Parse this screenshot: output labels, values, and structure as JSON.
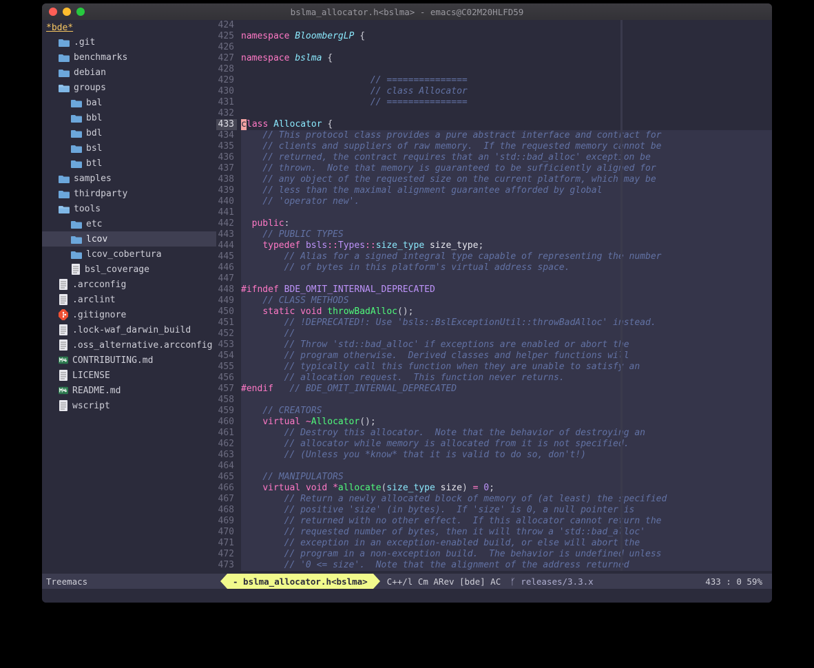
{
  "window": {
    "title": "bslma_allocator.h<bslma> - emacs@C02M20HLFD59"
  },
  "sidebar": {
    "root": "*bde*",
    "items": [
      {
        "type": "folder",
        "label": ".git",
        "indent": 1,
        "open": false
      },
      {
        "type": "folder",
        "label": "benchmarks",
        "indent": 1,
        "open": false
      },
      {
        "type": "folder",
        "label": "debian",
        "indent": 1,
        "open": false
      },
      {
        "type": "folder",
        "label": "groups",
        "indent": 1,
        "open": true
      },
      {
        "type": "folder",
        "label": "bal",
        "indent": 2,
        "open": false
      },
      {
        "type": "folder",
        "label": "bbl",
        "indent": 2,
        "open": false
      },
      {
        "type": "folder",
        "label": "bdl",
        "indent": 2,
        "open": false
      },
      {
        "type": "folder",
        "label": "bsl",
        "indent": 2,
        "open": false
      },
      {
        "type": "folder",
        "label": "btl",
        "indent": 2,
        "open": false
      },
      {
        "type": "folder",
        "label": "samples",
        "indent": 1,
        "open": false
      },
      {
        "type": "folder",
        "label": "thirdparty",
        "indent": 1,
        "open": false
      },
      {
        "type": "folder",
        "label": "tools",
        "indent": 1,
        "open": true
      },
      {
        "type": "folder",
        "label": "etc",
        "indent": 2,
        "open": false
      },
      {
        "type": "folder",
        "label": "lcov",
        "indent": 2,
        "open": false,
        "selected": true
      },
      {
        "type": "folder",
        "label": "lcov_cobertura",
        "indent": 2,
        "open": false
      },
      {
        "type": "file",
        "label": "bsl_coverage",
        "indent": 2,
        "icon": "doc"
      },
      {
        "type": "file",
        "label": ".arcconfig",
        "indent": 1,
        "icon": "doc"
      },
      {
        "type": "file",
        "label": ".arclint",
        "indent": 1,
        "icon": "doc"
      },
      {
        "type": "file",
        "label": ".gitignore",
        "indent": 1,
        "icon": "git"
      },
      {
        "type": "file",
        "label": ".lock-waf_darwin_build",
        "indent": 1,
        "icon": "doc"
      },
      {
        "type": "file",
        "label": ".oss_alternative.arcconfig",
        "indent": 1,
        "icon": "doc"
      },
      {
        "type": "file",
        "label": "CONTRIBUTING.md",
        "indent": 1,
        "icon": "md"
      },
      {
        "type": "file",
        "label": "LICENSE",
        "indent": 1,
        "icon": "doc"
      },
      {
        "type": "file",
        "label": "README.md",
        "indent": 1,
        "icon": "md"
      },
      {
        "type": "file",
        "label": "wscript",
        "indent": 1,
        "icon": "doc"
      }
    ]
  },
  "editor": {
    "first_line": 424,
    "current_line": 433,
    "lines": [
      {
        "n": 424,
        "tokens": []
      },
      {
        "n": 425,
        "tokens": [
          [
            "kw",
            "namespace"
          ],
          [
            "punct",
            " "
          ],
          [
            "ns",
            "BloombergLP"
          ],
          [
            "punct",
            " {"
          ]
        ]
      },
      {
        "n": 426,
        "tokens": []
      },
      {
        "n": 427,
        "tokens": [
          [
            "kw",
            "namespace"
          ],
          [
            "punct",
            " "
          ],
          [
            "ns",
            "bslma"
          ],
          [
            "punct",
            " {"
          ]
        ]
      },
      {
        "n": 428,
        "tokens": []
      },
      {
        "n": 429,
        "tokens": [
          [
            "punct",
            "                        "
          ],
          [
            "cmt",
            "// ==============="
          ]
        ]
      },
      {
        "n": 430,
        "tokens": [
          [
            "punct",
            "                        "
          ],
          [
            "cmt",
            "// class Allocator"
          ]
        ]
      },
      {
        "n": 431,
        "tokens": [
          [
            "punct",
            "                        "
          ],
          [
            "cmt",
            "// ==============="
          ]
        ]
      },
      {
        "n": 432,
        "tokens": []
      },
      {
        "n": 433,
        "cursor": true,
        "tokens": [
          [
            "kw",
            "lass"
          ],
          [
            "punct",
            " "
          ],
          [
            "cls",
            "Allocator"
          ],
          [
            "punct",
            " {"
          ]
        ]
      },
      {
        "n": 434,
        "hl": true,
        "tokens": [
          [
            "punct",
            "    "
          ],
          [
            "cmt",
            "// This protocol class provides a pure abstract interface and contract for"
          ]
        ]
      },
      {
        "n": 435,
        "hl": true,
        "tokens": [
          [
            "punct",
            "    "
          ],
          [
            "cmt",
            "// clients and suppliers of raw memory.  If the requested memory cannot be"
          ]
        ]
      },
      {
        "n": 436,
        "hl": true,
        "tokens": [
          [
            "punct",
            "    "
          ],
          [
            "cmt",
            "// returned, the contract requires that an 'std::bad_alloc' exception be"
          ]
        ]
      },
      {
        "n": 437,
        "hl": true,
        "tokens": [
          [
            "punct",
            "    "
          ],
          [
            "cmt",
            "// thrown.  Note that memory is guaranteed to be sufficiently aligned for"
          ]
        ]
      },
      {
        "n": 438,
        "hl": true,
        "tokens": [
          [
            "punct",
            "    "
          ],
          [
            "cmt",
            "// any object of the requested size on the current platform, which may be"
          ]
        ]
      },
      {
        "n": 439,
        "hl": true,
        "tokens": [
          [
            "punct",
            "    "
          ],
          [
            "cmt",
            "// less than the maximal alignment guarantee afforded by global"
          ]
        ]
      },
      {
        "n": 440,
        "hl": true,
        "tokens": [
          [
            "punct",
            "    "
          ],
          [
            "cmt",
            "// 'operator new'."
          ]
        ]
      },
      {
        "n": 441,
        "hl": true,
        "tokens": []
      },
      {
        "n": 442,
        "hl": true,
        "tokens": [
          [
            "punct",
            "  "
          ],
          [
            "kw",
            "public"
          ],
          [
            "punct",
            ":"
          ]
        ]
      },
      {
        "n": 443,
        "hl": true,
        "tokens": [
          [
            "punct",
            "    "
          ],
          [
            "cmt",
            "// PUBLIC TYPES"
          ]
        ]
      },
      {
        "n": 444,
        "hl": true,
        "tokens": [
          [
            "punct",
            "    "
          ],
          [
            "kw",
            "typedef"
          ],
          [
            "punct",
            " "
          ],
          [
            "type",
            "bsls"
          ],
          [
            "op",
            "::"
          ],
          [
            "type",
            "Types"
          ],
          [
            "op",
            "::"
          ],
          [
            "cls",
            "size_type"
          ],
          [
            "punct",
            " "
          ],
          [
            "ident",
            "size_type"
          ],
          [
            "punct",
            ";"
          ]
        ]
      },
      {
        "n": 445,
        "hl": true,
        "tokens": [
          [
            "punct",
            "        "
          ],
          [
            "cmt",
            "// Alias for a signed integral type capable of representing the number"
          ]
        ]
      },
      {
        "n": 446,
        "hl": true,
        "tokens": [
          [
            "punct",
            "        "
          ],
          [
            "cmt",
            "// of bytes in this platform's virtual address space."
          ]
        ]
      },
      {
        "n": 447,
        "hl": true,
        "tokens": []
      },
      {
        "n": 448,
        "hl": true,
        "tokens": [
          [
            "pp",
            "#ifndef"
          ],
          [
            "punct",
            " "
          ],
          [
            "ppv",
            "BDE_OMIT_INTERNAL_DEPRECATED"
          ]
        ]
      },
      {
        "n": 449,
        "hl": true,
        "tokens": [
          [
            "punct",
            "    "
          ],
          [
            "cmt",
            "// CLASS METHODS"
          ]
        ]
      },
      {
        "n": 450,
        "hl": true,
        "tokens": [
          [
            "punct",
            "    "
          ],
          [
            "kw",
            "static"
          ],
          [
            "punct",
            " "
          ],
          [
            "kw",
            "void"
          ],
          [
            "punct",
            " "
          ],
          [
            "func",
            "throwBadAlloc"
          ],
          [
            "punct",
            "();"
          ]
        ]
      },
      {
        "n": 451,
        "hl": true,
        "tokens": [
          [
            "punct",
            "        "
          ],
          [
            "cmt",
            "// !DEPRECATED!: Use 'bsls::BslExceptionUtil::throwBadAlloc' instead."
          ]
        ]
      },
      {
        "n": 452,
        "hl": true,
        "tokens": [
          [
            "punct",
            "        "
          ],
          [
            "cmt",
            "//"
          ]
        ]
      },
      {
        "n": 453,
        "hl": true,
        "tokens": [
          [
            "punct",
            "        "
          ],
          [
            "cmt",
            "// Throw 'std::bad_alloc' if exceptions are enabled or abort the"
          ]
        ]
      },
      {
        "n": 454,
        "hl": true,
        "tokens": [
          [
            "punct",
            "        "
          ],
          [
            "cmt",
            "// program otherwise.  Derived classes and helper functions will"
          ]
        ]
      },
      {
        "n": 455,
        "hl": true,
        "tokens": [
          [
            "punct",
            "        "
          ],
          [
            "cmt",
            "// typically call this function when they are unable to satisfy an"
          ]
        ]
      },
      {
        "n": 456,
        "hl": true,
        "tokens": [
          [
            "punct",
            "        "
          ],
          [
            "cmt",
            "// allocation request.  This function never returns."
          ]
        ]
      },
      {
        "n": 457,
        "hl": true,
        "tokens": [
          [
            "pp",
            "#endif"
          ],
          [
            "punct",
            "   "
          ],
          [
            "cmt",
            "// BDE_OMIT_INTERNAL_DEPRECATED"
          ]
        ]
      },
      {
        "n": 458,
        "hl": true,
        "tokens": []
      },
      {
        "n": 459,
        "hl": true,
        "tokens": [
          [
            "punct",
            "    "
          ],
          [
            "cmt",
            "// CREATORS"
          ]
        ]
      },
      {
        "n": 460,
        "hl": true,
        "tokens": [
          [
            "punct",
            "    "
          ],
          [
            "kw",
            "virtual"
          ],
          [
            "punct",
            " "
          ],
          [
            "op",
            "~"
          ],
          [
            "func",
            "Allocator"
          ],
          [
            "punct",
            "();"
          ]
        ]
      },
      {
        "n": 461,
        "hl": true,
        "tokens": [
          [
            "punct",
            "        "
          ],
          [
            "cmt",
            "// Destroy this allocator.  Note that the behavior of destroying an"
          ]
        ]
      },
      {
        "n": 462,
        "hl": true,
        "tokens": [
          [
            "punct",
            "        "
          ],
          [
            "cmt",
            "// allocator while memory is allocated from it is not specified."
          ]
        ]
      },
      {
        "n": 463,
        "hl": true,
        "tokens": [
          [
            "punct",
            "        "
          ],
          [
            "cmt",
            "// (Unless you *know* that it is valid to do so, don't!)"
          ]
        ]
      },
      {
        "n": 464,
        "hl": true,
        "tokens": []
      },
      {
        "n": 465,
        "hl": true,
        "tokens": [
          [
            "punct",
            "    "
          ],
          [
            "cmt",
            "// MANIPULATORS"
          ]
        ]
      },
      {
        "n": 466,
        "hl": true,
        "tokens": [
          [
            "punct",
            "    "
          ],
          [
            "kw",
            "virtual"
          ],
          [
            "punct",
            " "
          ],
          [
            "kw",
            "void"
          ],
          [
            "punct",
            " "
          ],
          [
            "op",
            "*"
          ],
          [
            "func",
            "allocate"
          ],
          [
            "punct",
            "("
          ],
          [
            "cls",
            "size_type"
          ],
          [
            "punct",
            " "
          ],
          [
            "ident",
            "size"
          ],
          [
            "punct",
            ") "
          ],
          [
            "op",
            "="
          ],
          [
            "punct",
            " "
          ],
          [
            "num",
            "0"
          ],
          [
            "punct",
            ";"
          ]
        ]
      },
      {
        "n": 467,
        "hl": true,
        "tokens": [
          [
            "punct",
            "        "
          ],
          [
            "cmt",
            "// Return a newly allocated block of memory of (at least) the specified"
          ]
        ]
      },
      {
        "n": 468,
        "hl": true,
        "tokens": [
          [
            "punct",
            "        "
          ],
          [
            "cmt",
            "// positive 'size' (in bytes).  If 'size' is 0, a null pointer is"
          ]
        ]
      },
      {
        "n": 469,
        "hl": true,
        "tokens": [
          [
            "punct",
            "        "
          ],
          [
            "cmt",
            "// returned with no other effect.  If this allocator cannot return the"
          ]
        ]
      },
      {
        "n": 470,
        "hl": true,
        "tokens": [
          [
            "punct",
            "        "
          ],
          [
            "cmt",
            "// requested number of bytes, then it will throw a 'std::bad_alloc'"
          ]
        ]
      },
      {
        "n": 471,
        "hl": true,
        "tokens": [
          [
            "punct",
            "        "
          ],
          [
            "cmt",
            "// exception in an exception-enabled build, or else will abort the"
          ]
        ]
      },
      {
        "n": 472,
        "hl": true,
        "tokens": [
          [
            "punct",
            "        "
          ],
          [
            "cmt",
            "// program in a non-exception build.  The behavior is undefined unless"
          ]
        ]
      },
      {
        "n": 473,
        "hl": true,
        "tokens": [
          [
            "punct",
            "        "
          ],
          [
            "cmt",
            "// '0 <= size'.  Note that the alignment of the address returned"
          ]
        ]
      }
    ]
  },
  "modeline": {
    "left": "Treemacs",
    "buffer_seg": "- bslma_allocator.h<bslma>",
    "mode": "C++/l Cm ARev [bde] AC",
    "branch_icon": "ᚶ",
    "branch": "releases/3.3.x",
    "position": "433 :  0   59%"
  }
}
